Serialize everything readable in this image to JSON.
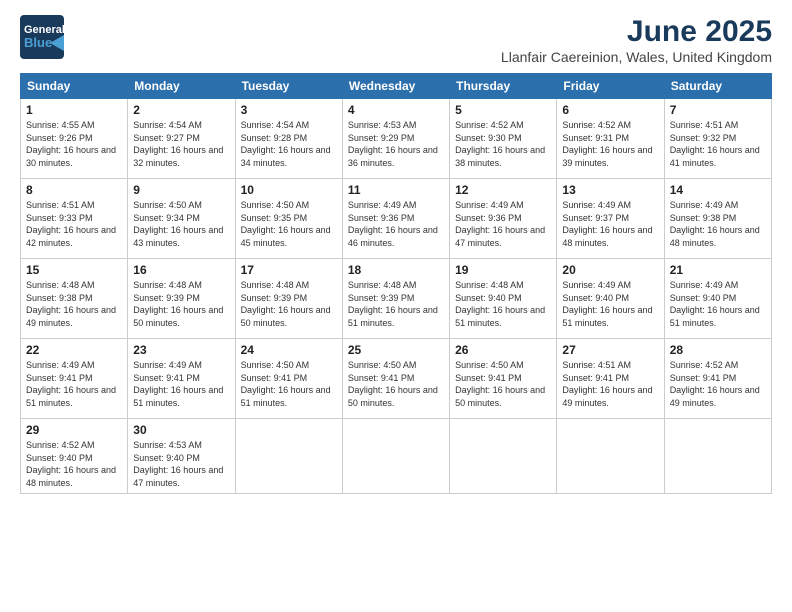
{
  "header": {
    "logo_line1": "General",
    "logo_line2": "Blue",
    "title": "June 2025",
    "subtitle": "Llanfair Caereinion, Wales, United Kingdom"
  },
  "weekdays": [
    "Sunday",
    "Monday",
    "Tuesday",
    "Wednesday",
    "Thursday",
    "Friday",
    "Saturday"
  ],
  "weeks": [
    [
      {
        "day": "1",
        "sunrise": "4:55 AM",
        "sunset": "9:26 PM",
        "daylight": "16 hours and 30 minutes."
      },
      {
        "day": "2",
        "sunrise": "4:54 AM",
        "sunset": "9:27 PM",
        "daylight": "16 hours and 32 minutes."
      },
      {
        "day": "3",
        "sunrise": "4:54 AM",
        "sunset": "9:28 PM",
        "daylight": "16 hours and 34 minutes."
      },
      {
        "day": "4",
        "sunrise": "4:53 AM",
        "sunset": "9:29 PM",
        "daylight": "16 hours and 36 minutes."
      },
      {
        "day": "5",
        "sunrise": "4:52 AM",
        "sunset": "9:30 PM",
        "daylight": "16 hours and 38 minutes."
      },
      {
        "day": "6",
        "sunrise": "4:52 AM",
        "sunset": "9:31 PM",
        "daylight": "16 hours and 39 minutes."
      },
      {
        "day": "7",
        "sunrise": "4:51 AM",
        "sunset": "9:32 PM",
        "daylight": "16 hours and 41 minutes."
      }
    ],
    [
      {
        "day": "8",
        "sunrise": "4:51 AM",
        "sunset": "9:33 PM",
        "daylight": "16 hours and 42 minutes."
      },
      {
        "day": "9",
        "sunrise": "4:50 AM",
        "sunset": "9:34 PM",
        "daylight": "16 hours and 43 minutes."
      },
      {
        "day": "10",
        "sunrise": "4:50 AM",
        "sunset": "9:35 PM",
        "daylight": "16 hours and 45 minutes."
      },
      {
        "day": "11",
        "sunrise": "4:49 AM",
        "sunset": "9:36 PM",
        "daylight": "16 hours and 46 minutes."
      },
      {
        "day": "12",
        "sunrise": "4:49 AM",
        "sunset": "9:36 PM",
        "daylight": "16 hours and 47 minutes."
      },
      {
        "day": "13",
        "sunrise": "4:49 AM",
        "sunset": "9:37 PM",
        "daylight": "16 hours and 48 minutes."
      },
      {
        "day": "14",
        "sunrise": "4:49 AM",
        "sunset": "9:38 PM",
        "daylight": "16 hours and 48 minutes."
      }
    ],
    [
      {
        "day": "15",
        "sunrise": "4:48 AM",
        "sunset": "9:38 PM",
        "daylight": "16 hours and 49 minutes."
      },
      {
        "day": "16",
        "sunrise": "4:48 AM",
        "sunset": "9:39 PM",
        "daylight": "16 hours and 50 minutes."
      },
      {
        "day": "17",
        "sunrise": "4:48 AM",
        "sunset": "9:39 PM",
        "daylight": "16 hours and 50 minutes."
      },
      {
        "day": "18",
        "sunrise": "4:48 AM",
        "sunset": "9:39 PM",
        "daylight": "16 hours and 51 minutes."
      },
      {
        "day": "19",
        "sunrise": "4:48 AM",
        "sunset": "9:40 PM",
        "daylight": "16 hours and 51 minutes."
      },
      {
        "day": "20",
        "sunrise": "4:49 AM",
        "sunset": "9:40 PM",
        "daylight": "16 hours and 51 minutes."
      },
      {
        "day": "21",
        "sunrise": "4:49 AM",
        "sunset": "9:40 PM",
        "daylight": "16 hours and 51 minutes."
      }
    ],
    [
      {
        "day": "22",
        "sunrise": "4:49 AM",
        "sunset": "9:41 PM",
        "daylight": "16 hours and 51 minutes."
      },
      {
        "day": "23",
        "sunrise": "4:49 AM",
        "sunset": "9:41 PM",
        "daylight": "16 hours and 51 minutes."
      },
      {
        "day": "24",
        "sunrise": "4:50 AM",
        "sunset": "9:41 PM",
        "daylight": "16 hours and 51 minutes."
      },
      {
        "day": "25",
        "sunrise": "4:50 AM",
        "sunset": "9:41 PM",
        "daylight": "16 hours and 50 minutes."
      },
      {
        "day": "26",
        "sunrise": "4:50 AM",
        "sunset": "9:41 PM",
        "daylight": "16 hours and 50 minutes."
      },
      {
        "day": "27",
        "sunrise": "4:51 AM",
        "sunset": "9:41 PM",
        "daylight": "16 hours and 49 minutes."
      },
      {
        "day": "28",
        "sunrise": "4:52 AM",
        "sunset": "9:41 PM",
        "daylight": "16 hours and 49 minutes."
      }
    ],
    [
      {
        "day": "29",
        "sunrise": "4:52 AM",
        "sunset": "9:40 PM",
        "daylight": "16 hours and 48 minutes."
      },
      {
        "day": "30",
        "sunrise": "4:53 AM",
        "sunset": "9:40 PM",
        "daylight": "16 hours and 47 minutes."
      },
      null,
      null,
      null,
      null,
      null
    ]
  ]
}
